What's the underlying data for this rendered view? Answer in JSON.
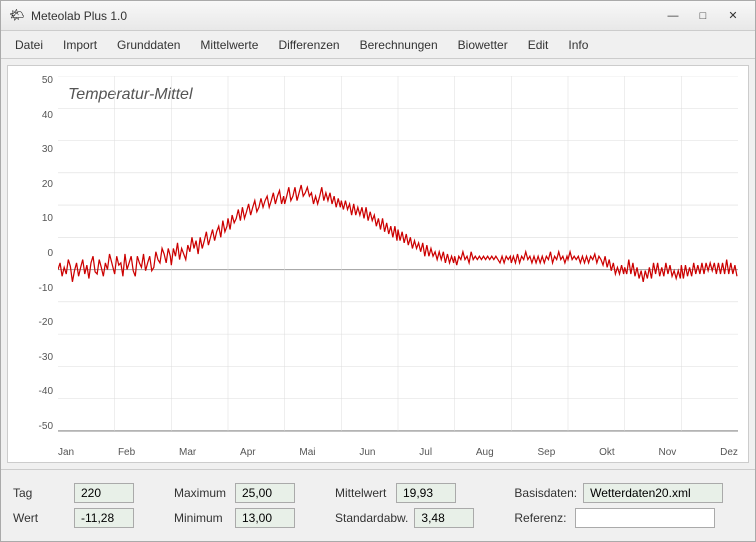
{
  "window": {
    "title": "Meteolab Plus 1.0",
    "icon": "🌤"
  },
  "titlebar": {
    "minimize": "—",
    "maximize": "□",
    "close": "✕"
  },
  "menu": {
    "items": [
      "Datei",
      "Import",
      "Grunddaten",
      "Mittelwerte",
      "Differenzen",
      "Berechnungen",
      "Biowetter",
      "Edit",
      "Info"
    ]
  },
  "chart": {
    "title": "Temperatur-Mittel",
    "yLabels": [
      "50",
      "40",
      "30",
      "20",
      "10",
      "0",
      "-10",
      "-20",
      "-30",
      "-40",
      "-50"
    ],
    "xLabels": [
      "Jan",
      "Feb",
      "Mar",
      "Apr",
      "Mai",
      "Jun",
      "Jul",
      "Aug",
      "Sep",
      "Okt",
      "Nov",
      "Dez"
    ]
  },
  "bottomPanel": {
    "fields": [
      {
        "label": "Tag",
        "value": "220"
      },
      {
        "label": "Wert",
        "value": "-11,28"
      },
      {
        "label": "Maximum",
        "value": "25,00"
      },
      {
        "label": "Minimum",
        "value": "13,00"
      },
      {
        "label": "Mittelwert",
        "value": "19,93"
      },
      {
        "label": "Standardabw.",
        "value": "3,48"
      },
      {
        "label": "Basisdaten:",
        "value": "Wetterdaten20.xml"
      },
      {
        "label": "Referenz:",
        "value": ""
      }
    ]
  }
}
